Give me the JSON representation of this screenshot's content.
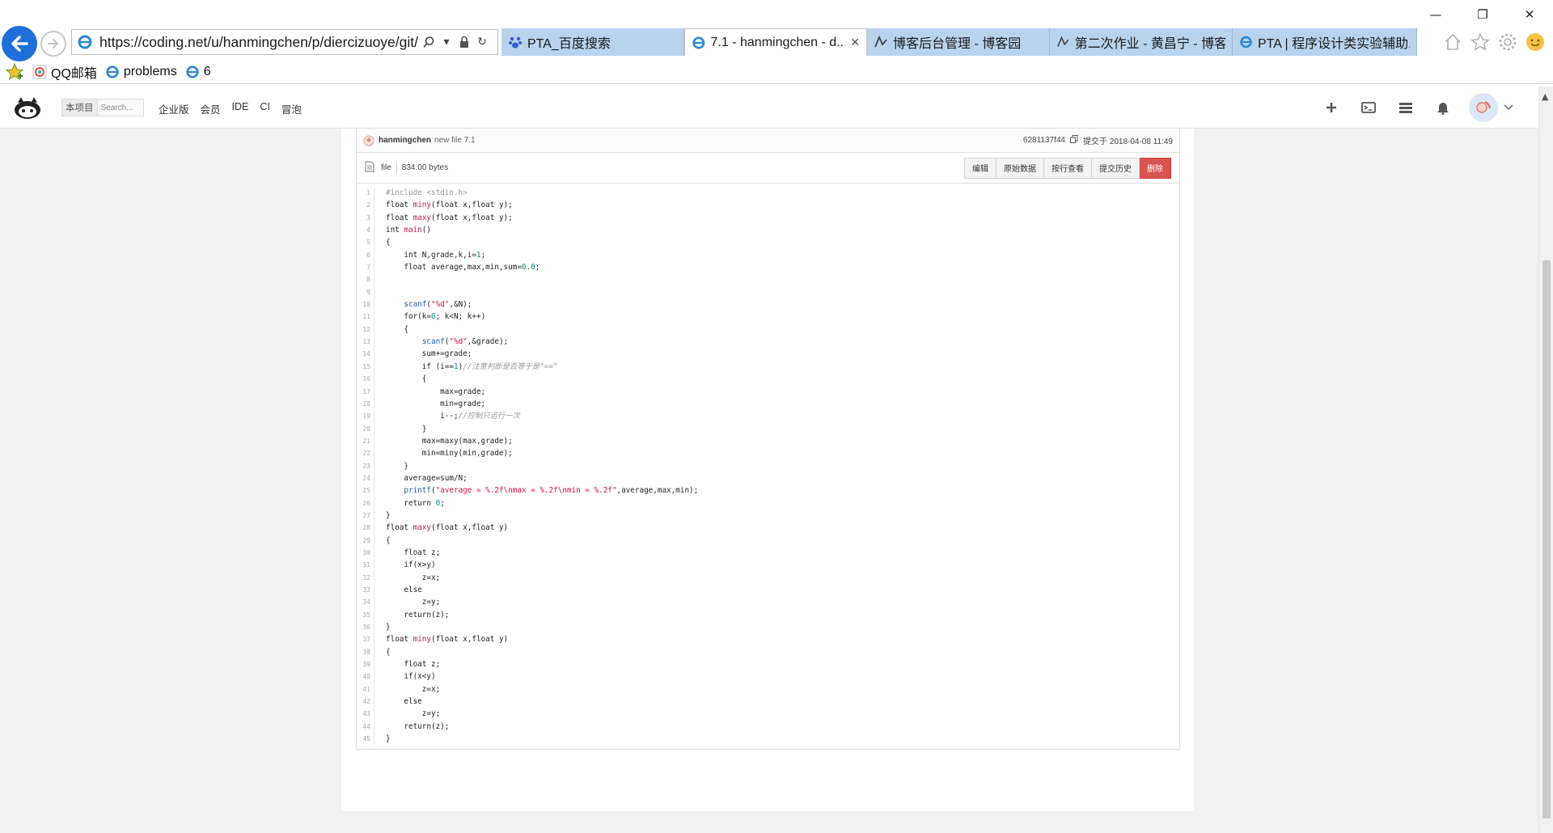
{
  "browser": {
    "url": "https://coding.net/u/hanmingchen/p/diercizuoye/git/",
    "tabs": [
      {
        "label": "PTA_百度搜索",
        "icon": "paw-icon",
        "active": false
      },
      {
        "label": "7.1 - hanmingchen - d...",
        "icon": "ie-icon",
        "active": true
      },
      {
        "label": "博客后台管理 - 博客园",
        "icon": "cnblogs-icon",
        "active": false
      },
      {
        "label": "第二次作业 - 黄昌宁 - 博客...",
        "icon": "cnblogs-icon",
        "active": false
      },
      {
        "label": "PTA | 程序设计类实验辅助...",
        "icon": "ie-icon",
        "active": false
      }
    ],
    "favorites": [
      {
        "label": "QQ邮箱",
        "icon": "qq-mail-icon"
      },
      {
        "label": "problems",
        "icon": "ie-icon"
      },
      {
        "label": "6",
        "icon": "ie-icon"
      }
    ]
  },
  "site": {
    "search_scope": "本项目",
    "search_placeholder": "Search...",
    "nav": [
      "企业版",
      "会员",
      "IDE",
      "CI",
      "冒泡"
    ]
  },
  "commit": {
    "author": "hanmingchen",
    "message": "new file 7.1",
    "hash": "6281137f44",
    "submitted": "提交于 2018-04-08 11:49"
  },
  "file": {
    "type": "file",
    "size": "834.00 bytes",
    "buttons": {
      "edit": "编辑",
      "raw": "原始数据",
      "blame": "按行查看",
      "history": "提交历史",
      "delete": "删除"
    }
  },
  "code_lines": [
    "#include <stdio.h>",
    "float miny(float x,float y);",
    "float maxy(float x,float y);",
    "int main()",
    "{",
    "    int N,grade,k,i=1;",
    "    float average,max,min,sum=0.0;",
    "",
    "",
    "    scanf(\"%d\",&N);",
    "    for(k=0; k<N; k++)",
    "    {",
    "        scanf(\"%d\",&grade);",
    "        sum+=grade;",
    "        if (i==1)//注意判断是否等于是\"==\"",
    "        {",
    "            max=grade;",
    "            min=grade;",
    "            i--;//控制只运行一次",
    "        }",
    "        max=maxy(max,grade);",
    "        min=miny(min,grade);",
    "    }",
    "    average=sum/N;",
    "    printf(\"average = %.2f\\nmax = %.2f\\nmin = %.2f\",average,max,min);",
    "    return 0;",
    "}",
    "float maxy(float x,float y)",
    "{",
    "    float z;",
    "    if(x>y)",
    "        z=x;",
    "    else",
    "        z=y;",
    "    return(z);",
    "}",
    "float miny(float x,float y)",
    "{",
    "    float z;",
    "    if(x<y)",
    "        z=x;",
    "    else",
    "        z=y;",
    "    return(z);",
    "}"
  ],
  "colors": {
    "accent": "#1e6fd9",
    "tab_bg": "#b9d3ec",
    "danger": "#d9534f",
    "func": "#c02050",
    "string": "#dd1144",
    "number": "#0a8a8a",
    "comment": "#999999"
  }
}
